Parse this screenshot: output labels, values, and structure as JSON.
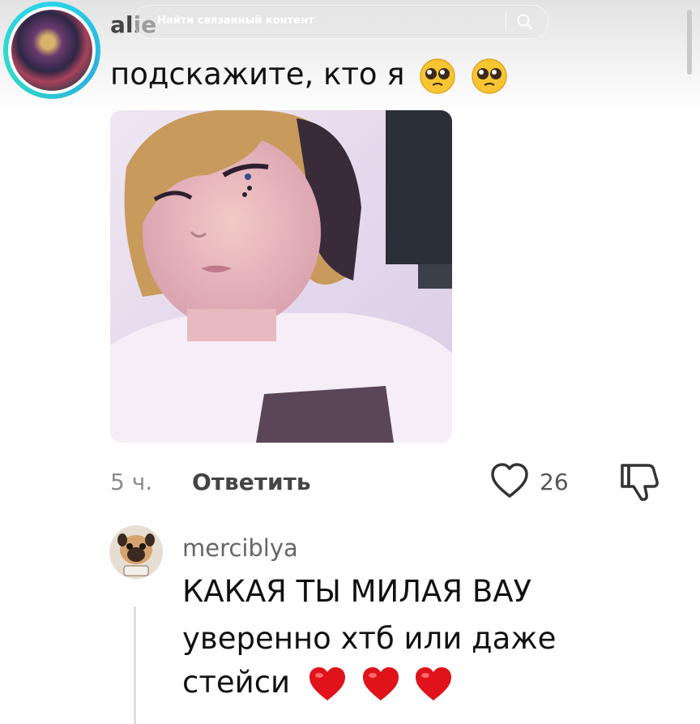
{
  "search": {
    "placeholder": "Найти связанный контент"
  },
  "comment": {
    "username": "alie",
    "text": "подскажите, кто я",
    "emojis": [
      "pleading-face",
      "pleading-face"
    ],
    "time": "5 ч.",
    "reply_label": "Ответить",
    "likes": "26"
  },
  "reply": {
    "username": "merciblya",
    "line1": "КАКАЯ ТЫ МИЛАЯ ВАУ",
    "line2": "уверенно хтб или даже",
    "line3": "стейси",
    "emojis": [
      "red-heart",
      "red-heart",
      "red-heart"
    ]
  },
  "colors": {
    "avatar_ring": "#29d3e8",
    "heart_emoji": "#e0121a"
  }
}
